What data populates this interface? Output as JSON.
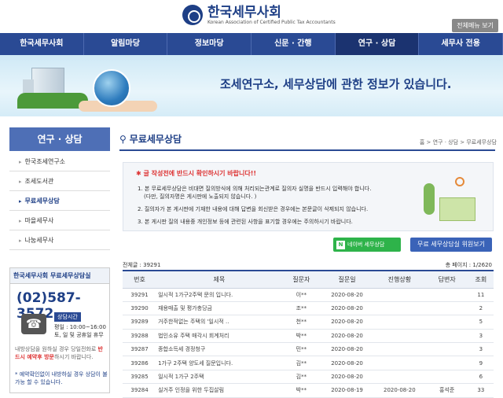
{
  "header": {
    "logo_title": "한국세무사회",
    "logo_sub": "Korean Association of Certified Public Tax Accountants",
    "allmenu": "전체메뉴 보기"
  },
  "nav": [
    "한국세무사회",
    "알림마당",
    "정보마당",
    "신문 · 간행",
    "연구 · 상담",
    "세무사 전용"
  ],
  "banner": {
    "text": "조세연구소, 세무상담에 관한 정보가 있습니다."
  },
  "sidebar": {
    "title": "연구 · 상담",
    "items": [
      "한국조세연구소",
      "조세도서관",
      "무료세무상담",
      "마을세무사",
      "나눔세무사"
    ]
  },
  "cs": {
    "head": "한국세무사회 무료세무상담실",
    "phone": "(02)587-3572",
    "badge": "상담시간",
    "hours1": "평일 : 10:00~16:00",
    "hours2": "토, 일 및 공휴일 휴무",
    "note_a": "내방상담을 원하실 경우 당일전화로 ",
    "note_b": "반드시 예약후 방문",
    "note_c": "하시기 바랍니다.",
    "note2": "* 예약확인없이 내방하실 경우 상담이 불가능 할 수 있습니다."
  },
  "page": {
    "title": "무료세무상담",
    "breadcrumb": "홈 > 연구 · 상담 > 무료세무상담"
  },
  "notice": {
    "title": "✱ 글 작성전에 반드시 확인하시기 바랍니다!!",
    "item1a": "1. 본 무료세무상담은 비대면 질의방식에 의해 처리되는관계로 질의자 실명을 반드시 입력해야 합니다.",
    "item1b": "(다만, 질의자명은 게시판에 노출되지 않습니다. )",
    "item2": "2. 질의자가 본 게시판에 기재한 내용에 대해 답변을 회신받은 경우에는 본문글이 삭제되지 않습니다.",
    "item3": "3. 본 게시판 질의 내용중 개인정보 등에 관련된 사항을 표기할 경우에는 주의하시기 바랍니다."
  },
  "buttons": {
    "naver_small": "한국세무사회와 함께하는",
    "naver": "네이버 세무상담",
    "go": "무료 세무상담실 위원보기"
  },
  "list": {
    "total": "전체글 : 39291",
    "pageinfo": "총 페이지 : 1/2620",
    "headers": [
      "번호",
      "제목",
      "질문자",
      "질문일",
      "진행상황",
      "답변자",
      "조회"
    ],
    "rows": [
      [
        "39291",
        "일시적 1가구2주택 문의 입니다.",
        "이**",
        "2020-08-20",
        "",
        "",
        "11"
      ],
      [
        "39290",
        "재용매출 및 평가충당금",
        "조**",
        "2020-08-20",
        "",
        "",
        "2"
      ],
      [
        "39289",
        "거주한적없는 주택의 '일시적 ..",
        "천**",
        "2020-08-20",
        "",
        "",
        "5"
      ],
      [
        "39288",
        "법인소유 주택 매각시 회계처리",
        "박**",
        "2020-08-20",
        "",
        "",
        "3"
      ],
      [
        "39287",
        "종합소득세 경정청구",
        "민**",
        "2020-08-20",
        "",
        "",
        "3"
      ],
      [
        "39286",
        "1가구 2주택 양도세 질문입니다.",
        "김**",
        "2020-08-20",
        "",
        "",
        "9"
      ],
      [
        "39285",
        "일시적 1가구 2주택",
        "김**",
        "2020-08-20",
        "",
        "",
        "6"
      ],
      [
        "39284",
        "실거주 인정을 위한 두집살림",
        "박**",
        "2020-08-19",
        "2020-08-20",
        "홍석준",
        "33"
      ]
    ]
  }
}
